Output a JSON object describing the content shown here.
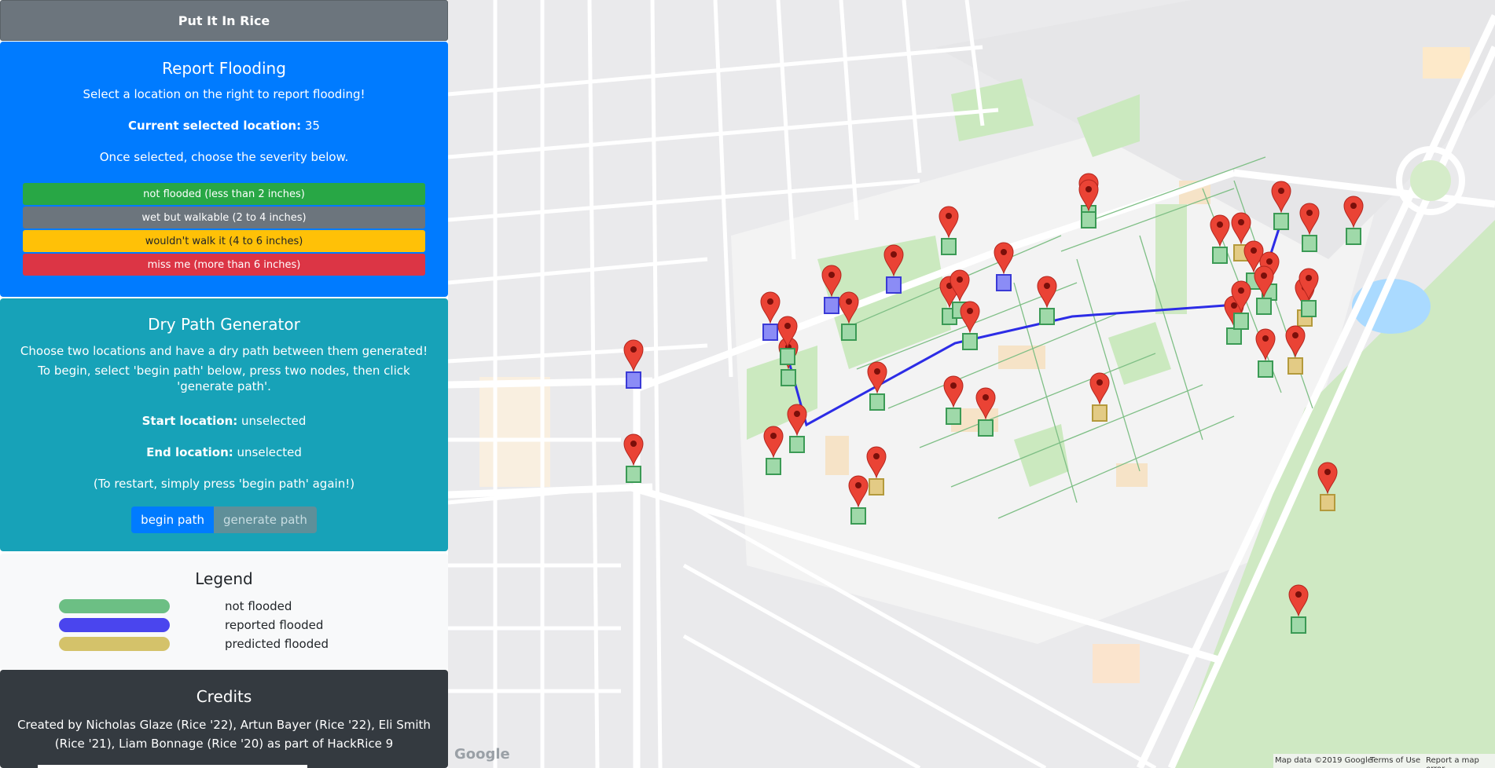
{
  "app": {
    "title": "Put It In Rice"
  },
  "report": {
    "heading": "Report Flooding",
    "instruction": "Select a location on the right to report flooding!",
    "current_label": "Current selected location:",
    "current_value": "35",
    "severity_note": "Once selected, choose the severity below.",
    "buttons": [
      {
        "label": "not flooded (less than 2 inches)",
        "color": "#28a745",
        "text_color": "#ffffff"
      },
      {
        "label": "wet but walkable (2 to 4 inches)",
        "color": "#6c757d",
        "text_color": "#ffffff"
      },
      {
        "label": "wouldn't walk it (4 to 6 inches)",
        "color": "#ffc107",
        "text_color": "#212529"
      },
      {
        "label": "miss me (more than 6 inches)",
        "color": "#dc3545",
        "text_color": "#ffffff"
      }
    ]
  },
  "drypath": {
    "heading": "Dry Path Generator",
    "line1": "Choose two locations and have a dry path between them generated!",
    "line2": "To begin, select 'begin path' below, press two nodes, then click 'generate path'.",
    "start_label": "Start location:",
    "start_value": "unselected",
    "end_label": "End location:",
    "end_value": "unselected",
    "restart_note": "(To restart, simply press 'begin path' again!)",
    "begin_label": "begin path",
    "generate_label": "generate path"
  },
  "legend": {
    "heading": "Legend",
    "items": [
      {
        "label": "not flooded",
        "color": "#6cbf84"
      },
      {
        "label": "reported flooded",
        "color": "#4a45ee"
      },
      {
        "label": "predicted flooded",
        "color": "#d4c26a"
      }
    ]
  },
  "credits": {
    "heading": "Credits",
    "text": "Created by Nicholas Glaze (Rice '22), Artun Bayer (Rice '22), Eli Smith (Rice '21), Liam Bonnage (Rice '20) as part of HackRice 9"
  },
  "map": {
    "logo": "Google",
    "attribution": "Map data ©2019 Google",
    "terms": "Terms of Use",
    "report_error": "Report a map error",
    "markers": [
      {
        "status": "blue"
      },
      {
        "status": "green"
      },
      {
        "status": "blue"
      },
      {
        "status": "green"
      },
      {
        "status": "green"
      },
      {
        "status": "green"
      },
      {
        "status": "green"
      },
      {
        "status": "green"
      },
      {
        "status": "green"
      },
      {
        "status": "blue"
      },
      {
        "status": "green"
      },
      {
        "status": "yellow"
      },
      {
        "status": "green"
      },
      {
        "status": "green"
      },
      {
        "status": "green"
      },
      {
        "status": "blue"
      },
      {
        "status": "green"
      },
      {
        "status": "green"
      },
      {
        "status": "blue"
      },
      {
        "status": "green"
      },
      {
        "status": "yellow"
      },
      {
        "status": "green"
      },
      {
        "status": "green"
      },
      {
        "status": "green"
      },
      {
        "status": "green"
      },
      {
        "status": "yellow"
      },
      {
        "status": "green"
      },
      {
        "status": "green"
      },
      {
        "status": "yellow"
      },
      {
        "status": "green"
      },
      {
        "status": "green"
      },
      {
        "status": "green"
      },
      {
        "status": "green"
      },
      {
        "status": "green"
      },
      {
        "status": "yellow"
      },
      {
        "status": "green"
      },
      {
        "status": "green"
      },
      {
        "status": "yellow"
      },
      {
        "status": "green"
      },
      {
        "status": "green"
      }
    ]
  }
}
